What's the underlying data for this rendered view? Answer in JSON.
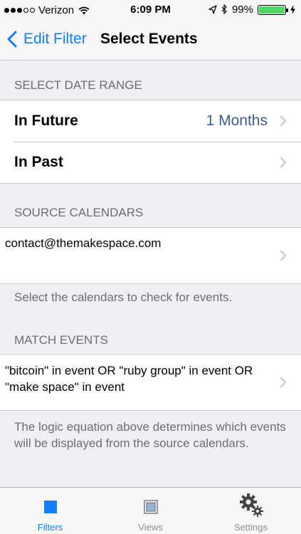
{
  "status_bar": {
    "carrier": "Verizon",
    "time": "6:09 PM",
    "battery_percent": "99%",
    "battery_level": 0.99,
    "signal_bars_filled": 3,
    "signal_bars_total": 5
  },
  "nav": {
    "back_label": "Edit Filter",
    "title": "Select Events"
  },
  "date_range": {
    "header": "SELECT DATE RANGE",
    "rows": [
      {
        "label": "In Future",
        "value": "1 Months"
      },
      {
        "label": "In Past",
        "value": ""
      }
    ]
  },
  "source_calendars": {
    "header": "SOURCE CALENDARS",
    "calendar": "contact@themakespace.com",
    "footer": "Select the calendars to check for events."
  },
  "match_events": {
    "header": "MATCH EVENTS",
    "expression": "\"bitcoin\" in event OR \"ruby group\" in event OR \"make space\" in event",
    "footer": "The logic equation above determines which events will be displayed from the source calendars."
  },
  "tab_bar": {
    "tabs": [
      {
        "label": "Filters",
        "icon": "filters-icon",
        "active": true
      },
      {
        "label": "Views",
        "icon": "views-icon",
        "active": false
      },
      {
        "label": "Settings",
        "icon": "gear-icon",
        "active": false
      }
    ]
  },
  "colors": {
    "accent": "#157efb",
    "value_text": "#3a5f8f",
    "battery": "#4cd964",
    "group_background": "#efeff4"
  }
}
